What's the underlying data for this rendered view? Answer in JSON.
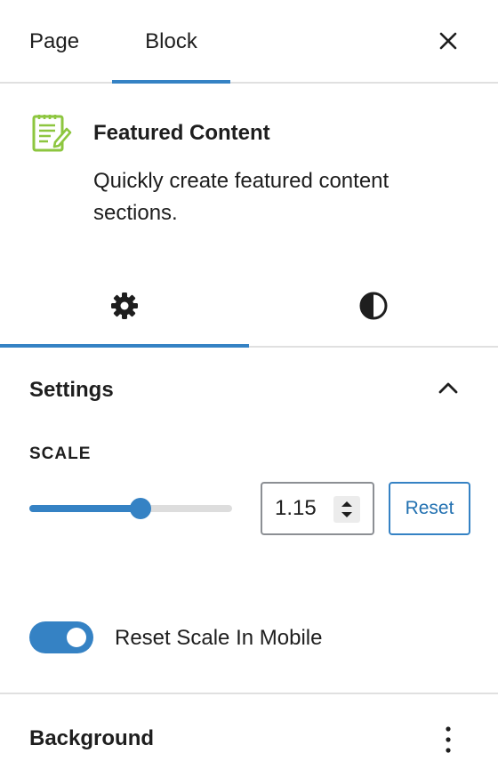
{
  "top_tabs": {
    "page_label": "Page",
    "block_label": "Block",
    "active": "Block"
  },
  "block": {
    "icon": "featured-content-icon",
    "title": "Featured Content",
    "description": "Quickly create featured content sections."
  },
  "inspector_tabs": [
    {
      "icon": "gear-icon",
      "active": true
    },
    {
      "icon": "contrast-icon",
      "active": false
    }
  ],
  "settings_panel": {
    "title": "Settings",
    "expanded": true,
    "scale": {
      "label": "SCALE",
      "value": "1.15",
      "slider_fraction": 0.55,
      "reset_label": "Reset"
    },
    "toggle": {
      "label": "Reset Scale In Mobile",
      "checked": true
    }
  },
  "background_panel": {
    "title": "Background"
  },
  "colors": {
    "accent": "#3582c4",
    "icon_green": "#8dc63f",
    "text": "#1e1e1e"
  }
}
